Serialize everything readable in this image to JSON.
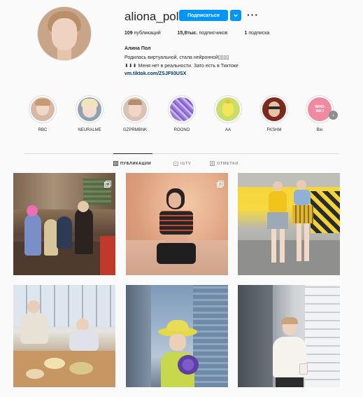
{
  "profile": {
    "username": "aliona_pole",
    "follow_label": "Подписаться",
    "stats": {
      "posts": "109",
      "posts_label": "публикаций",
      "followers": "15,8тыс.",
      "followers_label": "подписчиков",
      "following": "1",
      "following_label": "подписка"
    },
    "full_name": "Алина Пол",
    "bio_line1": "Родилась виртуальной, стала нейронной▯▯▯▯",
    "bio_line2": "⬇⬇⬇ Меня нет в реальности. Зато есть в Тиктоке",
    "link": "vm.tiktok.com/ZSJF93USX"
  },
  "highlights": [
    {
      "label": "RBC",
      "icon": "woman-portrait"
    },
    {
      "label": "NEURALME",
      "icon": "blonde-portrait"
    },
    {
      "label": "GZPRMBNK",
      "icon": "short-hair-portrait"
    },
    {
      "label": "ROONO",
      "icon": "purple-texture"
    },
    {
      "label": "AA",
      "icon": "yellow-character"
    },
    {
      "label": "FKSHM",
      "icon": "glasses-portrait"
    },
    {
      "label": "Bio",
      "icon": "who-am-i-badge",
      "badge_text": "WHO AM I"
    }
  ],
  "tabs": [
    {
      "label": "ПУБЛИКАЦИИ",
      "active": true,
      "icon": "grid-icon"
    },
    {
      "label": "IGTV",
      "active": false,
      "icon": "igtv-icon"
    },
    {
      "label": "ОТМЕТКИ",
      "active": false,
      "icon": "tag-icon"
    }
  ],
  "posts": [
    {
      "scene": "bar-friends",
      "multi": true
    },
    {
      "scene": "sport-outfit",
      "multi": true
    },
    {
      "scene": "yellow-parking",
      "multi": false
    },
    {
      "scene": "restaurant-table",
      "multi": false
    },
    {
      "scene": "city-flowers",
      "multi": false
    },
    {
      "scene": "street-coffee",
      "multi": false
    }
  ],
  "colors": {
    "accent": "#0095f6",
    "link": "#00376b",
    "text": "#262626",
    "muted": "#8e8e8e",
    "border": "#dbdbdb"
  }
}
